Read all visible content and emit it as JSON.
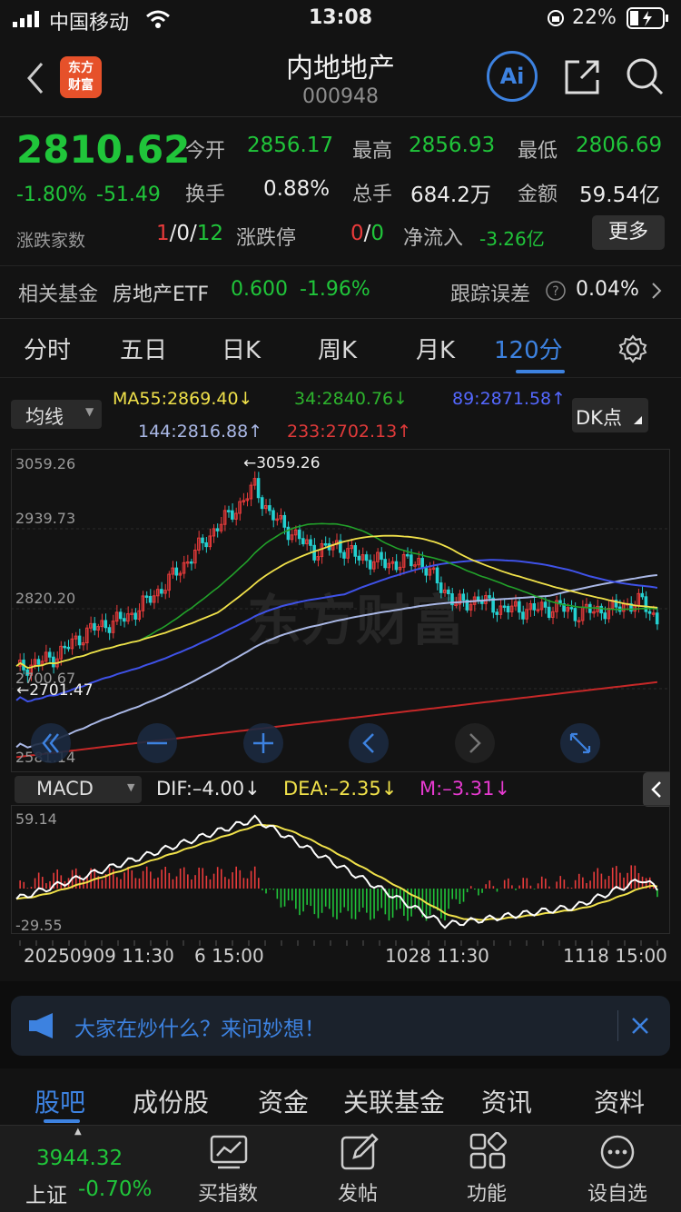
{
  "status_bar": {
    "carrier": "中国移动",
    "time": "13:08",
    "battery": "22%"
  },
  "header": {
    "title": "内地地产",
    "code": "000948",
    "logo_line1": "东方",
    "logo_line2": "财富",
    "ai_label": "Ai"
  },
  "quote": {
    "price": "2810.62",
    "change_pct": "-1.80%",
    "change": "-51.49",
    "open_label": "今开",
    "open": "2856.17",
    "high_label": "最高",
    "high": "2856.93",
    "low_label": "最低",
    "low": "2806.69",
    "turnover_label": "换手",
    "turnover": "0.88%",
    "volume_label": "总手",
    "volume": "684.2万",
    "amount_label": "金额",
    "amount": "59.54亿",
    "updown_label": "涨跌家数",
    "up": "1",
    "sep1": "/",
    "flat": "0",
    "sep2": "/",
    "down": "12",
    "limit_label": "涨跌停",
    "limit_up": "0",
    "sep3": "/",
    "limit_down": "0",
    "netflow_label": "净流入",
    "netflow": "-3.26亿",
    "more_label": "更多"
  },
  "fund": {
    "label": "相关基金",
    "name": "房地产ETF",
    "price": "0.600",
    "pct": "-1.96%",
    "tracking_label": "跟踪误差",
    "tracking": "0.04%"
  },
  "tabs": [
    "分时",
    "五日",
    "日K",
    "周K",
    "月K",
    "120分"
  ],
  "indicator": {
    "selector": "均线",
    "ma55": "MA55:2869.40↓",
    "ma34": "34:2840.76↓",
    "ma89": "89:2871.58↑",
    "ma144": "144:2816.88↑",
    "ma233": "233:2702.13↑",
    "dk": "DK点"
  },
  "chart_axis": {
    "y_top": "3059.26",
    "y2": "2939.73",
    "y3": "2820.20",
    "y4": "2700.67",
    "y_bottom": "2581.14",
    "max_marker": "←3059.26",
    "min_marker": "←2701.47",
    "watermark": "东方财富"
  },
  "macd": {
    "selector": "MACD",
    "dif": "DIF:–4.00↓",
    "dea": "DEA:–2.35↓",
    "m": "M:–3.31↓",
    "y_top": "59.14",
    "y_bottom": "-29.55"
  },
  "x_axis": {
    "d1": "20250909 11:30",
    "d1b": "6 15:00",
    "d2": "1028 11:30",
    "d3": "1118 15:00"
  },
  "banner": {
    "text": "大家在炒什么？来问妙想！"
  },
  "bottom_tabs": [
    "股吧",
    "成份股",
    "资金",
    "关联基金",
    "资讯",
    "资料"
  ],
  "nav": {
    "index_value": "3944.32",
    "index_name": "上证",
    "index_pct": "-0.70%",
    "buy_index": "买指数",
    "post": "发帖",
    "function": "功能",
    "settings": "设自选"
  },
  "colors": {
    "up": "#e83b3b",
    "down": "#20c53a",
    "accent": "#3d82e0",
    "ma55": "#f0e14a",
    "ma34": "#2db32d",
    "ma89": "#4a5cff",
    "ma144": "#aab8e6",
    "ma233": "#c62828"
  },
  "chart_data": {
    "type": "line",
    "series": [
      {
        "name": "MA55",
        "last": 2869.4
      },
      {
        "name": "34",
        "last": 2840.76
      },
      {
        "name": "89",
        "last": 2871.58
      },
      {
        "name": "144",
        "last": 2816.88
      },
      {
        "name": "233",
        "last": 2702.13
      }
    ],
    "ylim": [
      2581.14,
      3059.26
    ],
    "high": 3059.26,
    "low": 2701.47,
    "macd": {
      "DIF": -4.0,
      "DEA": -2.35,
      "M": -3.31,
      "ylim": [
        -29.55,
        59.14
      ]
    }
  }
}
